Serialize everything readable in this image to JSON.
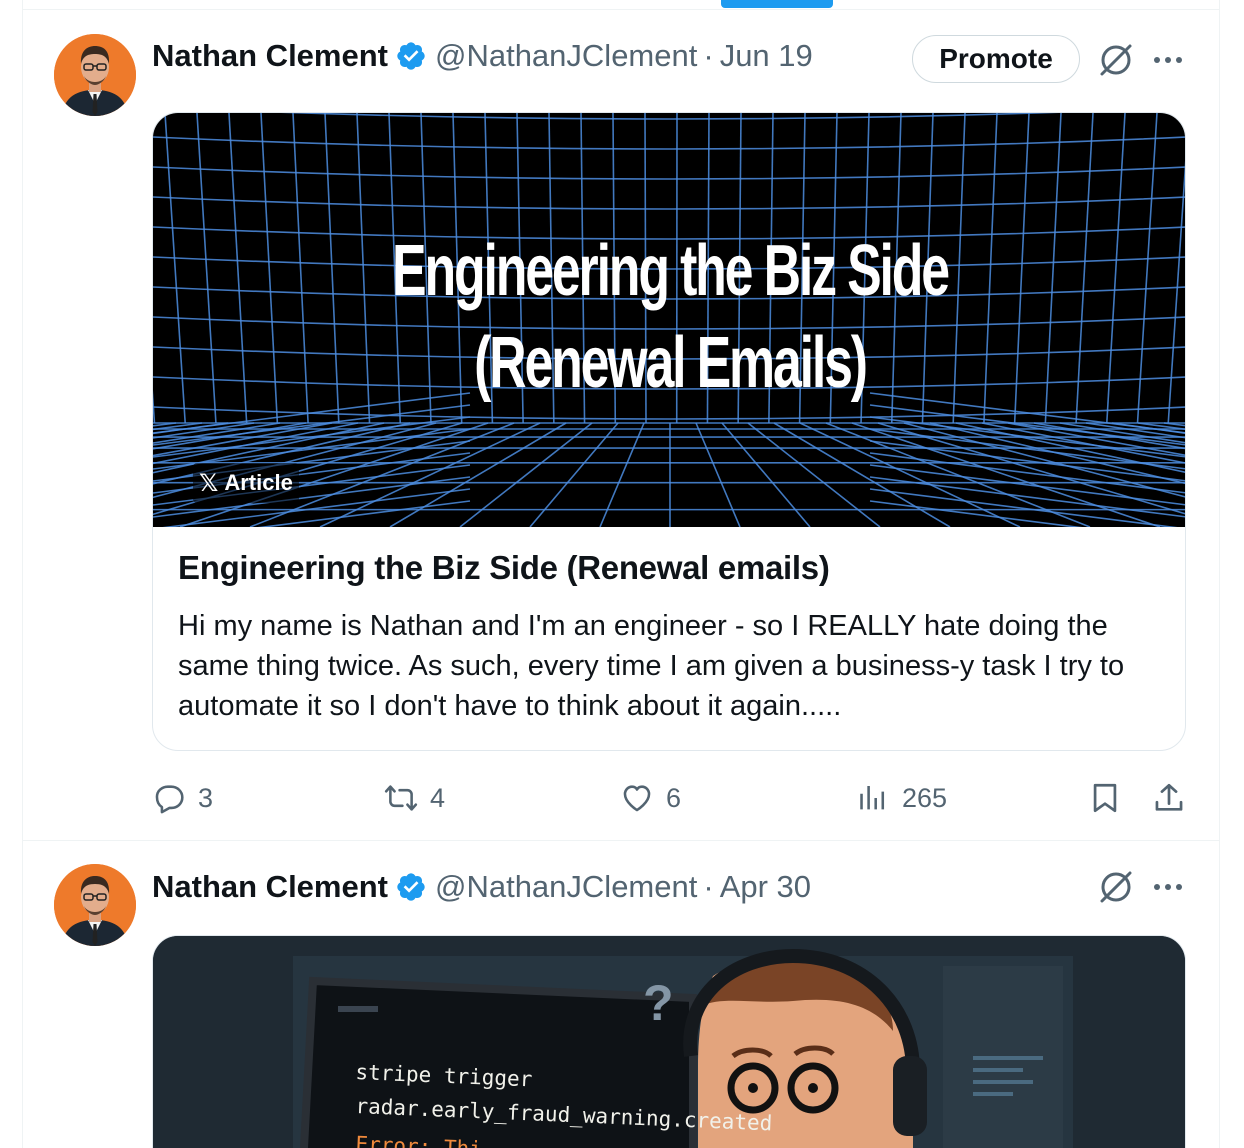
{
  "colors": {
    "accent": "#1d9bf0",
    "text_primary": "#0f1419",
    "text_secondary": "#536471",
    "avatar_bg": "#ee7a2b"
  },
  "tweets": [
    {
      "author_name": "Nathan Clement",
      "handle": "@NathanJClement",
      "separator": "·",
      "date": "Jun 19",
      "promote_label": "Promote",
      "card": {
        "image_title_line1": "Engineering the Biz Side",
        "image_title_line2": "(Renewal Emails)",
        "badge_label": "Article",
        "badge_x": "𝕏",
        "title": "Engineering the Biz Side (Renewal emails)",
        "excerpt": "Hi my name is Nathan and I'm an engineer - so I REALLY hate doing the same thing twice. As such, every time I am given a business-y task I try to automate it so I don't have to think about it again....."
      },
      "stats": {
        "replies": "3",
        "reposts": "4",
        "likes": "6",
        "views": "265"
      },
      "icons": [
        "verified-badge-icon",
        "grok-icon",
        "more-icon",
        "reply-icon",
        "repost-icon",
        "like-icon",
        "views-icon",
        "bookmark-icon",
        "share-icon"
      ]
    },
    {
      "author_name": "Nathan Clement",
      "handle": "@NathanJClement",
      "separator": "·",
      "date": "Apr 30",
      "media": {
        "question_mark": "?",
        "code_line1": "stripe trigger",
        "code_line2": "radar.early_fraud_warning.created",
        "code_line3": "Error: Thi"
      }
    }
  ]
}
